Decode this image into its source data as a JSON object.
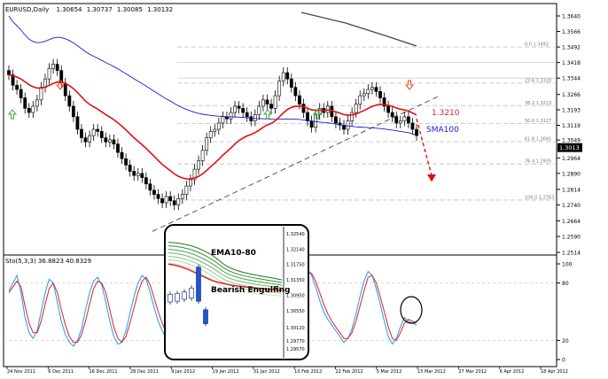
{
  "chart_data": [
    {
      "type": "candlestick",
      "title": "EURUSD,Daily",
      "header_values": [
        "1.30654",
        "1.30737",
        "1.30085",
        "1.30132"
      ],
      "y_ticks": [
        "1.3640",
        "1.3566",
        "1.3492",
        "1.3418",
        "1.3344",
        "1.3266",
        "1.3193",
        "1.3119",
        "1.3049",
        "1.2964",
        "1.2890",
        "1.2814",
        "1.2740",
        "1.2664",
        "1.2590",
        "1.2514"
      ],
      "last_price_label": "1.3013",
      "fib_levels": [
        {
          "label": "0.0",
          "value": 1.3492
        },
        {
          "label": "23.6",
          "value": 1.332
        },
        {
          "label": "38.2",
          "value": 1.3213
        },
        {
          "label": "50.0",
          "value": 1.3127
        },
        {
          "label": "61.8",
          "value": 1.3041
        },
        {
          "label": "76.4",
          "value": 1.2935
        },
        {
          "label": "100.0",
          "value": 1.2763
        }
      ],
      "x_ticks": [
        "24 Nov 2011",
        "6 Dec 2011",
        "16 Dec 2011",
        "28 Dec 2011",
        "9 Jan 2012",
        "19 Jan 2012",
        "31 Jan 2012",
        "10 Feb 2012",
        "22 Feb 2012",
        "5 Mar 2012",
        "15 Mar 2012",
        "27 Mar 2012",
        "6 Apr 2012",
        "18 Apr 2012"
      ],
      "ohlc_close": [
        1.336,
        1.331,
        1.329,
        1.325,
        1.32,
        1.318,
        1.321,
        1.324,
        1.33,
        1.334,
        1.339,
        1.341,
        1.338,
        1.332,
        1.326,
        1.321,
        1.316,
        1.31,
        1.306,
        1.304,
        1.307,
        1.31,
        1.309,
        1.306,
        1.304,
        1.305,
        1.303,
        1.299,
        1.296,
        1.293,
        1.29,
        1.288,
        1.289,
        1.287,
        1.284,
        1.281,
        1.279,
        1.277,
        1.275,
        1.278,
        1.276,
        1.274,
        1.277,
        1.279,
        1.283,
        1.286,
        1.291,
        1.295,
        1.3,
        1.306,
        1.309,
        1.31,
        1.313,
        1.316,
        1.315,
        1.318,
        1.321,
        1.32,
        1.318,
        1.316,
        1.314,
        1.317,
        1.321,
        1.324,
        1.322,
        1.32,
        1.326,
        1.333,
        1.337,
        1.334,
        1.33,
        1.326,
        1.322,
        1.318,
        1.314,
        1.311,
        1.317,
        1.32,
        1.318,
        1.321,
        1.316,
        1.313,
        1.312,
        1.31,
        1.314,
        1.318,
        1.322,
        1.326,
        1.327,
        1.329,
        1.33,
        1.328,
        1.325,
        1.321,
        1.318,
        1.316,
        1.313,
        1.314,
        1.316,
        1.313,
        1.31,
        1.307
      ],
      "annotations": [
        "1.3210",
        "SMA100"
      ],
      "legend_items": [
        "EMA10-80",
        "Bearish Engulfing"
      ],
      "series": [
        {
          "name": "SMA100",
          "color": "#1a1ad6"
        },
        {
          "name": "EMA",
          "color": "#e01010"
        }
      ],
      "colors": {
        "up": "#ffffff",
        "down": "#000000",
        "trend": "#444444",
        "grid": "#c8c8c8",
        "arrow_up": "#33aa33",
        "arrow_down": "#e05020"
      }
    },
    {
      "type": "line",
      "title": "Sto(5,3,3) 36.8823 40.8329",
      "y_ticks": [
        "100",
        "80",
        "20",
        "0"
      ],
      "series": [
        {
          "name": "Sto main",
          "color": "#2299ee",
          "values": [
            72,
            80,
            88,
            70,
            44,
            28,
            22,
            30,
            50,
            70,
            84,
            80,
            60,
            40,
            26,
            18,
            14,
            20,
            32,
            52,
            70,
            82,
            86,
            78,
            60,
            40,
            24,
            16,
            18,
            30,
            48,
            66,
            80,
            88,
            84,
            70,
            54,
            40,
            30,
            22,
            16,
            20,
            32,
            48,
            64,
            78,
            86,
            90,
            84,
            72,
            58,
            44,
            34,
            26,
            22,
            28,
            42,
            58,
            72,
            82,
            80,
            66,
            50,
            36,
            24,
            18,
            16,
            20,
            28,
            40,
            56,
            70,
            84,
            92,
            94,
            88,
            76,
            62,
            50,
            42,
            36,
            30,
            24,
            18,
            22,
            32,
            48,
            66,
            82,
            92,
            88,
            74,
            58,
            40,
            24,
            16,
            22,
            34,
            44,
            40,
            38,
            36
          ]
        },
        {
          "name": "Sto signal",
          "color": "#dd2222",
          "values": [
            70,
            76,
            82,
            76,
            56,
            38,
            28,
            28,
            40,
            58,
            74,
            80,
            70,
            52,
            36,
            24,
            18,
            18,
            26,
            40,
            58,
            74,
            82,
            80,
            70,
            52,
            34,
            22,
            18,
            24,
            38,
            54,
            70,
            82,
            86,
            78,
            64,
            50,
            38,
            28,
            20,
            18,
            26,
            40,
            54,
            68,
            80,
            86,
            86,
            78,
            66,
            52,
            40,
            32,
            26,
            26,
            36,
            50,
            64,
            76,
            80,
            72,
            58,
            44,
            32,
            22,
            18,
            18,
            24,
            34,
            48,
            62,
            76,
            86,
            92,
            90,
            82,
            70,
            58,
            48,
            40,
            34,
            28,
            22,
            22,
            28,
            40,
            56,
            72,
            86,
            88,
            80,
            66,
            50,
            34,
            22,
            20,
            28,
            38,
            42,
            40,
            38
          ]
        }
      ]
    }
  ]
}
